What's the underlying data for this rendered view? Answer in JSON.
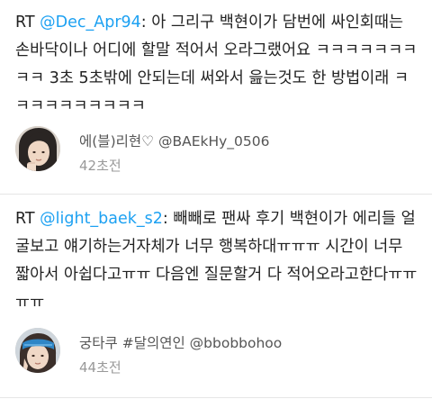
{
  "tweets": [
    {
      "rt_prefix": "RT ",
      "mention": "@Dec_Apr94",
      "body": ": 아 그리구 백현이가 담번에 싸인회때는 손바닥이나 어디에 할말 적어서 오라그랬어요 ㅋㅋㅋㅋㅋㅋㅋㅋㅋ 3초 5초밖에 안되는데 써와서 읊는것도 한 방법이래 ㅋㅋㅋㅋㅋㅋㅋㅋㅋㅋ",
      "author": "에(블)리현♡ @BAEkHy_0506",
      "time": "42초전"
    },
    {
      "rt_prefix": "RT ",
      "mention": "@light_baek_s2",
      "body": ": 빼빼로 팬싸 후기 백현이가 에리들 얼굴보고 얘기하는거자체가 너무 행복하대ㅠㅠㅠ 시간이 너무 짧아서 아쉽다고ㅠㅠ 다음엔 질문할거 다 적어오라고한다ㅠㅠㅠㅠ",
      "author": "궁타쿠 #달의연인 @bbobbohoo",
      "time": "44초전"
    }
  ],
  "colors": {
    "mention": "#1da1f2",
    "text": "#222222",
    "meta": "#999999",
    "divider": "#e6e6e6"
  }
}
